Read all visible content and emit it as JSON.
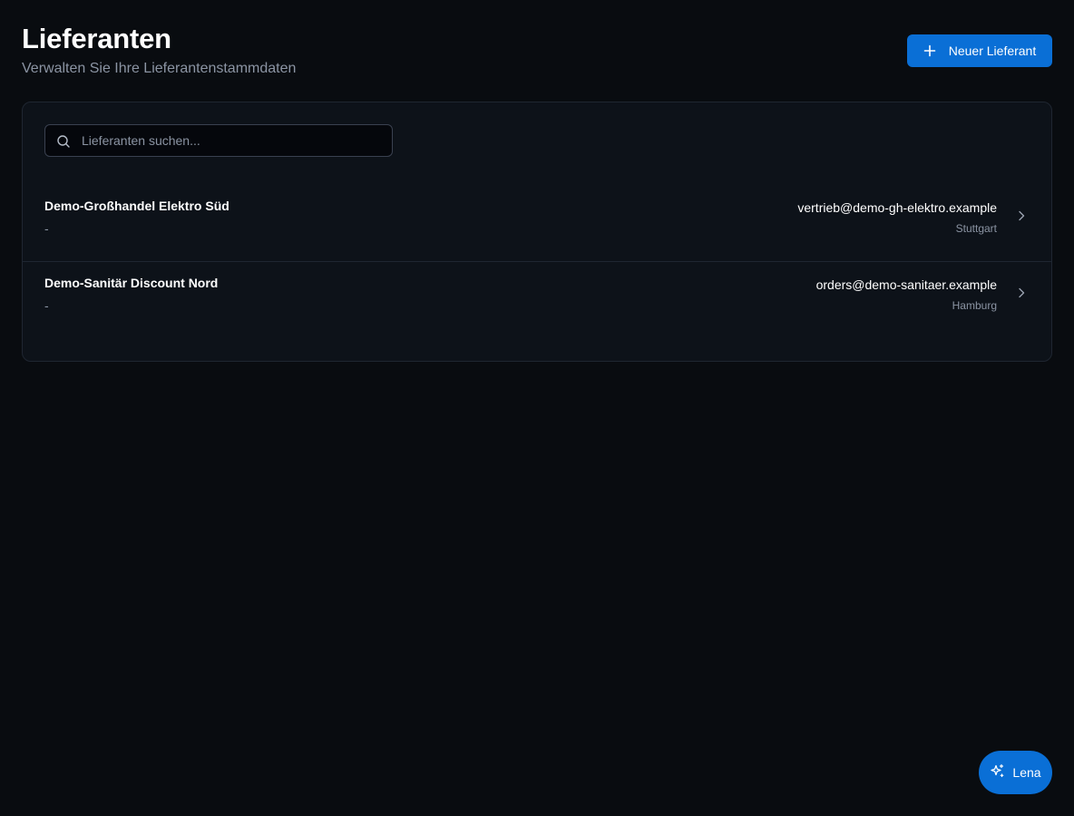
{
  "header": {
    "title": "Lieferanten",
    "subtitle": "Verwalten Sie Ihre Lieferantenstammdaten",
    "new_button_label": "Neuer Lieferant",
    "new_button_icon": "plus-icon"
  },
  "search": {
    "placeholder": "Lieferanten suchen...",
    "value": "",
    "icon": "search-icon"
  },
  "suppliers": [
    {
      "name": "Demo-Großhandel Elektro Süd",
      "subline": "-",
      "email": "vertrieb@demo-gh-elektro.example",
      "city": "Stuttgart"
    },
    {
      "name": "Demo-Sanitär Discount Nord",
      "subline": "-",
      "email": "orders@demo-sanitaer.example",
      "city": "Hamburg"
    }
  ],
  "assistant": {
    "label": "Lena",
    "icon": "sparkles-icon"
  },
  "colors": {
    "background": "#090c10",
    "card": "#0d1219",
    "accent": "#0a6fd6",
    "muted_text": "#8b94a3"
  }
}
